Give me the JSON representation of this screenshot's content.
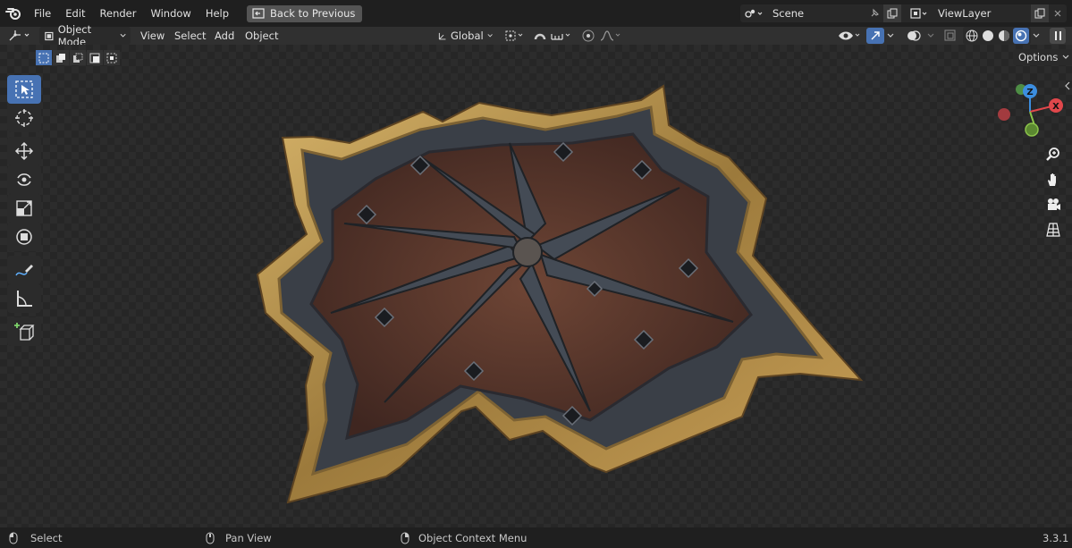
{
  "menubar": {
    "items": [
      "File",
      "Edit",
      "Render",
      "Window",
      "Help"
    ],
    "back_button": "Back to Previous",
    "scene_name": "Scene",
    "view_layer": "ViewLayer"
  },
  "header": {
    "mode": "Object Mode",
    "menus": [
      "View",
      "Select",
      "Add",
      "Object"
    ],
    "orientation": "Global"
  },
  "viewport": {
    "options_label": "Options",
    "gizmo_axes": [
      "Z",
      "X"
    ]
  },
  "toolbar": {
    "tools": [
      "select-box",
      "cursor",
      "move",
      "rotate",
      "scale",
      "transform",
      "annotate",
      "measure",
      "add-cube"
    ],
    "active_tool": "select-box"
  },
  "statusbar": {
    "select": "Select",
    "pan": "Pan View",
    "context": "Object Context Menu",
    "version": "3.3.1"
  },
  "colors": {
    "accent": "#4772b3",
    "axis_x": "#e0474b",
    "axis_y": "#8bc34a",
    "axis_z": "#3c8ee0",
    "background": "#262626"
  }
}
